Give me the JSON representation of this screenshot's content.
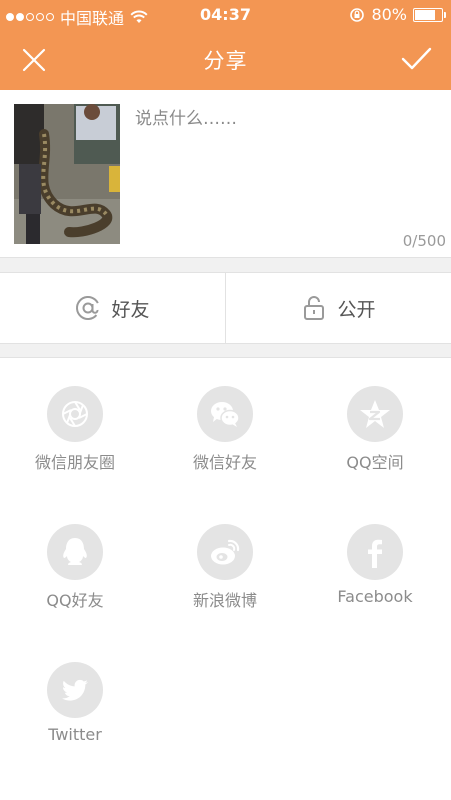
{
  "status_bar": {
    "carrier": "中国联通",
    "time": "04:37",
    "battery_percent": "80%",
    "battery_level": 0.8
  },
  "nav": {
    "title": "分享"
  },
  "compose": {
    "placeholder": "说点什么……",
    "counter": "0/500"
  },
  "options": {
    "mention_label": "好友",
    "privacy_label": "公开"
  },
  "share": {
    "items": [
      {
        "label": "微信朋友圈",
        "icon": "wechat-moments-icon"
      },
      {
        "label": "微信好友",
        "icon": "wechat-icon"
      },
      {
        "label": "QQ空间",
        "icon": "qzone-icon"
      },
      {
        "label": "QQ好友",
        "icon": "qq-icon"
      },
      {
        "label": "新浪微博",
        "icon": "weibo-icon"
      },
      {
        "label": "Facebook",
        "icon": "facebook-icon"
      },
      {
        "label": "Twitter",
        "icon": "twitter-icon"
      }
    ]
  },
  "colors": {
    "accent": "#F39653",
    "icon_circle": "#E4E4E4",
    "icon_glyph": "#FFFFFF"
  }
}
